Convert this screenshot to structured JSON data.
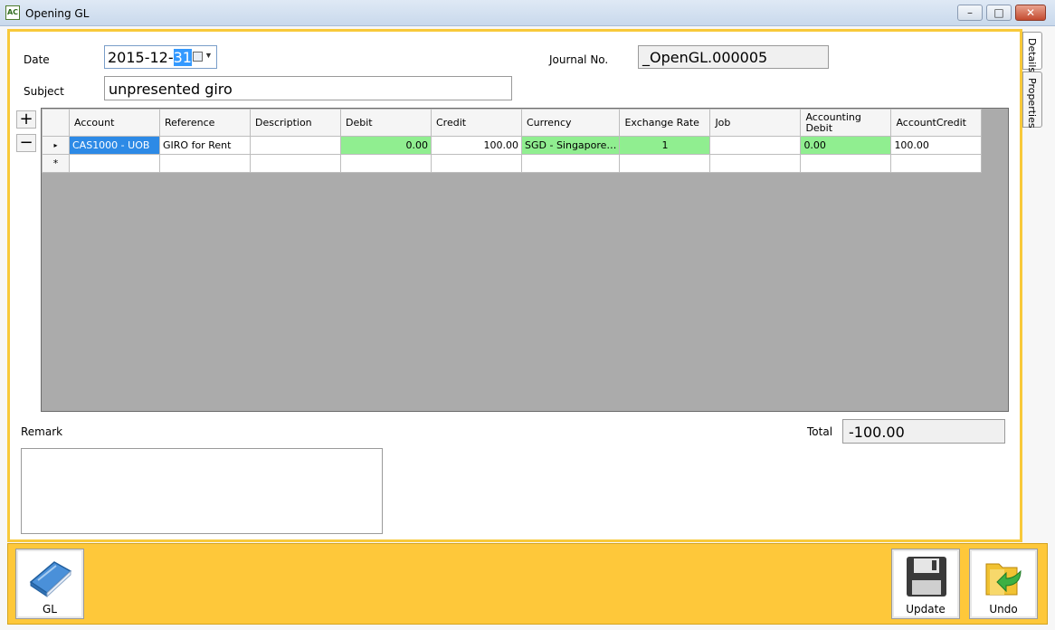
{
  "window": {
    "title": "Opening GL",
    "app_icon_text": "AC",
    "min_glyph": "–",
    "max_glyph": "□",
    "close_glyph": "✕"
  },
  "form": {
    "date_label": "Date",
    "date_value_prefix": "2015-12-",
    "date_value_selected": "31",
    "subject_label": "Subject",
    "subject_value": "unpresented giro",
    "journal_label": "Journal No.",
    "journal_value": "_OpenGL.000005"
  },
  "grid_buttons": {
    "add": "+",
    "remove": "−"
  },
  "grid": {
    "columns": [
      "Account",
      "Reference",
      "Description",
      "Debit",
      "Credit",
      "Currency",
      "Exchange Rate",
      "Job",
      "Accounting Debit",
      "AccountCredit"
    ],
    "rows": [
      {
        "indicator": "▸",
        "account": "CAS1000 - UOB",
        "reference": "GIRO for Rent",
        "description": "",
        "debit": "0.00",
        "credit": "100.00",
        "currency": "SGD - Singapore…",
        "exchange_rate": "1",
        "job": "",
        "accounting_debit": "0.00",
        "account_credit": "100.00"
      }
    ],
    "new_row_indicator": "*"
  },
  "footer": {
    "remark_label": "Remark",
    "total_label": "Total",
    "total_value": "-100.00"
  },
  "tabs": {
    "details": "Details",
    "properties": "Properties"
  },
  "actions": {
    "gl": "GL",
    "update": "Update",
    "undo": "Undo"
  },
  "colors": {
    "accent_bar": "#fec83a",
    "panel_border": "#f8c93a",
    "green_cell": "#90ee90",
    "selected_cell": "#2d8ae6"
  }
}
